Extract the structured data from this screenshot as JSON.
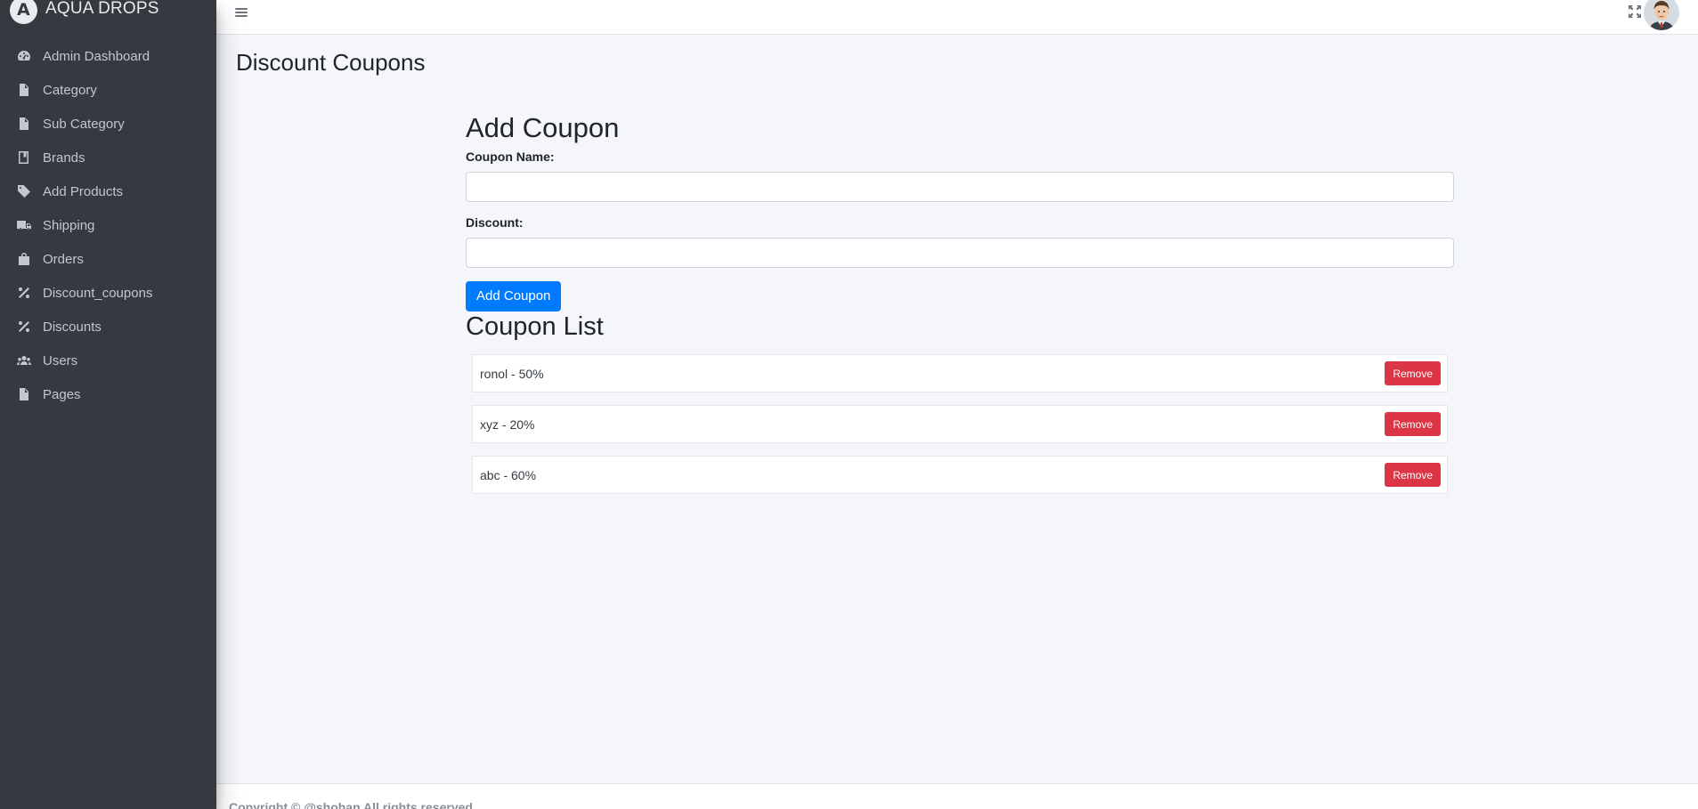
{
  "brand": {
    "name": "AQUA DROPS",
    "logo_letter": "A"
  },
  "sidebar": {
    "items": [
      {
        "label": "Admin Dashboard",
        "icon": "dashboard-icon"
      },
      {
        "label": "Category",
        "icon": "file-icon"
      },
      {
        "label": "Sub Category",
        "icon": "file-icon"
      },
      {
        "label": "Brands",
        "icon": "book-icon"
      },
      {
        "label": "Add Products",
        "icon": "tag-icon"
      },
      {
        "label": "Shipping",
        "icon": "truck-icon"
      },
      {
        "label": "Orders",
        "icon": "shopping-bag-icon"
      },
      {
        "label": "Discount_coupons",
        "icon": "percent-icon"
      },
      {
        "label": "Discounts",
        "icon": "percent-icon"
      },
      {
        "label": "Users",
        "icon": "users-icon"
      },
      {
        "label": "Pages",
        "icon": "file-icon"
      }
    ]
  },
  "topbar": {
    "menu_icon": "hamburger-icon",
    "fullscreen_icon": "expand-icon",
    "avatar": "user-avatar"
  },
  "page": {
    "title": "Discount Coupons"
  },
  "form": {
    "heading": "Add Coupon",
    "coupon_name_label": "Coupon Name:",
    "coupon_name_value": "",
    "discount_label": "Discount:",
    "discount_value": "",
    "submit_label": "Add Coupon"
  },
  "list": {
    "heading": "Coupon List",
    "items": [
      {
        "text": "ronol - 50%",
        "action": "Remove"
      },
      {
        "text": "xyz - 20%",
        "action": "Remove"
      },
      {
        "text": "abc - 60%",
        "action": "Remove"
      }
    ]
  },
  "footer": {
    "text": "Copyright © @shohan All rights reserved"
  },
  "colors": {
    "sidebar": "#343a40",
    "primary": "#007bff",
    "danger": "#dc3545",
    "background": "#f4f6f9"
  }
}
